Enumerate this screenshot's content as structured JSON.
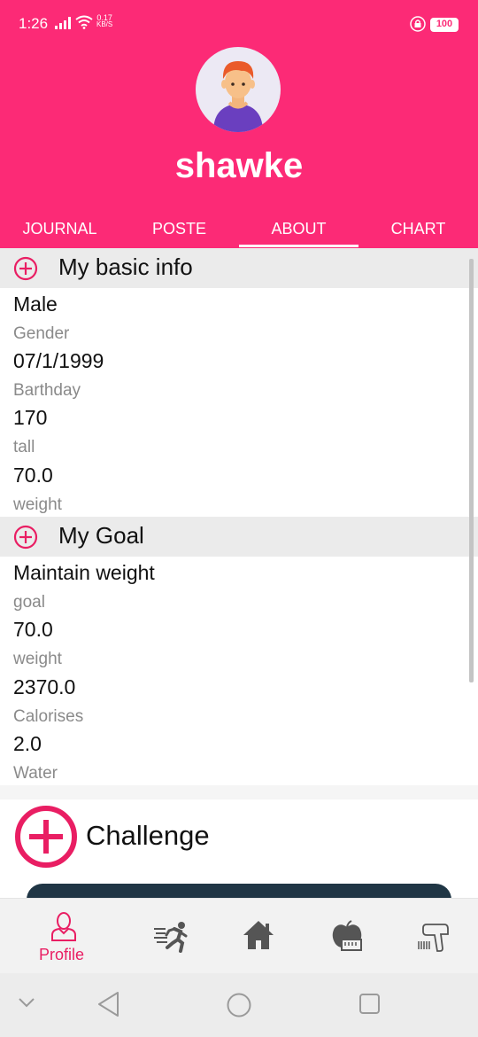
{
  "status_bar": {
    "time": "1:26",
    "net_speed_value": "0.17",
    "net_speed_unit": "KB/S",
    "battery": "100",
    "icons": [
      "signal-icon",
      "wifi-icon",
      "lock-icon",
      "battery-icon"
    ]
  },
  "profile": {
    "username": "shawke",
    "avatar": "avatar-boy-icon"
  },
  "tabs": [
    {
      "label": "JOURNAL"
    },
    {
      "label": "POSTE"
    },
    {
      "label": "ABOUT"
    },
    {
      "label": "CHART"
    }
  ],
  "selected_tab": "ABOUT",
  "basic_info": {
    "title": "My basic info",
    "fields": [
      {
        "value": "Male",
        "label": "Gender"
      },
      {
        "value": "07/1/1999",
        "label": "Barthday"
      },
      {
        "value": "170",
        "label": "tall"
      },
      {
        "value": "70.0",
        "label": "weight"
      }
    ]
  },
  "goal": {
    "title": "My Goal",
    "fields": [
      {
        "value": "Maintain weight",
        "label": "goal"
      },
      {
        "value": "70.0",
        "label": "weight"
      },
      {
        "value": "2370.0",
        "label": "Calorises"
      },
      {
        "value": "2.0",
        "label": "Water"
      }
    ]
  },
  "challenge": {
    "label": "Challenge"
  },
  "bottom_nav": {
    "items": [
      {
        "icon": "profile-icon",
        "label": "Profile",
        "active": true
      },
      {
        "icon": "running-icon"
      },
      {
        "icon": "home-icon"
      },
      {
        "icon": "apple-scale-icon"
      },
      {
        "icon": "scanner-icon"
      }
    ]
  },
  "colors": {
    "primary": "#fc2a76",
    "section_bg": "#ebebeb",
    "dark_card": "#203645",
    "nav_active": "#e91e63"
  }
}
